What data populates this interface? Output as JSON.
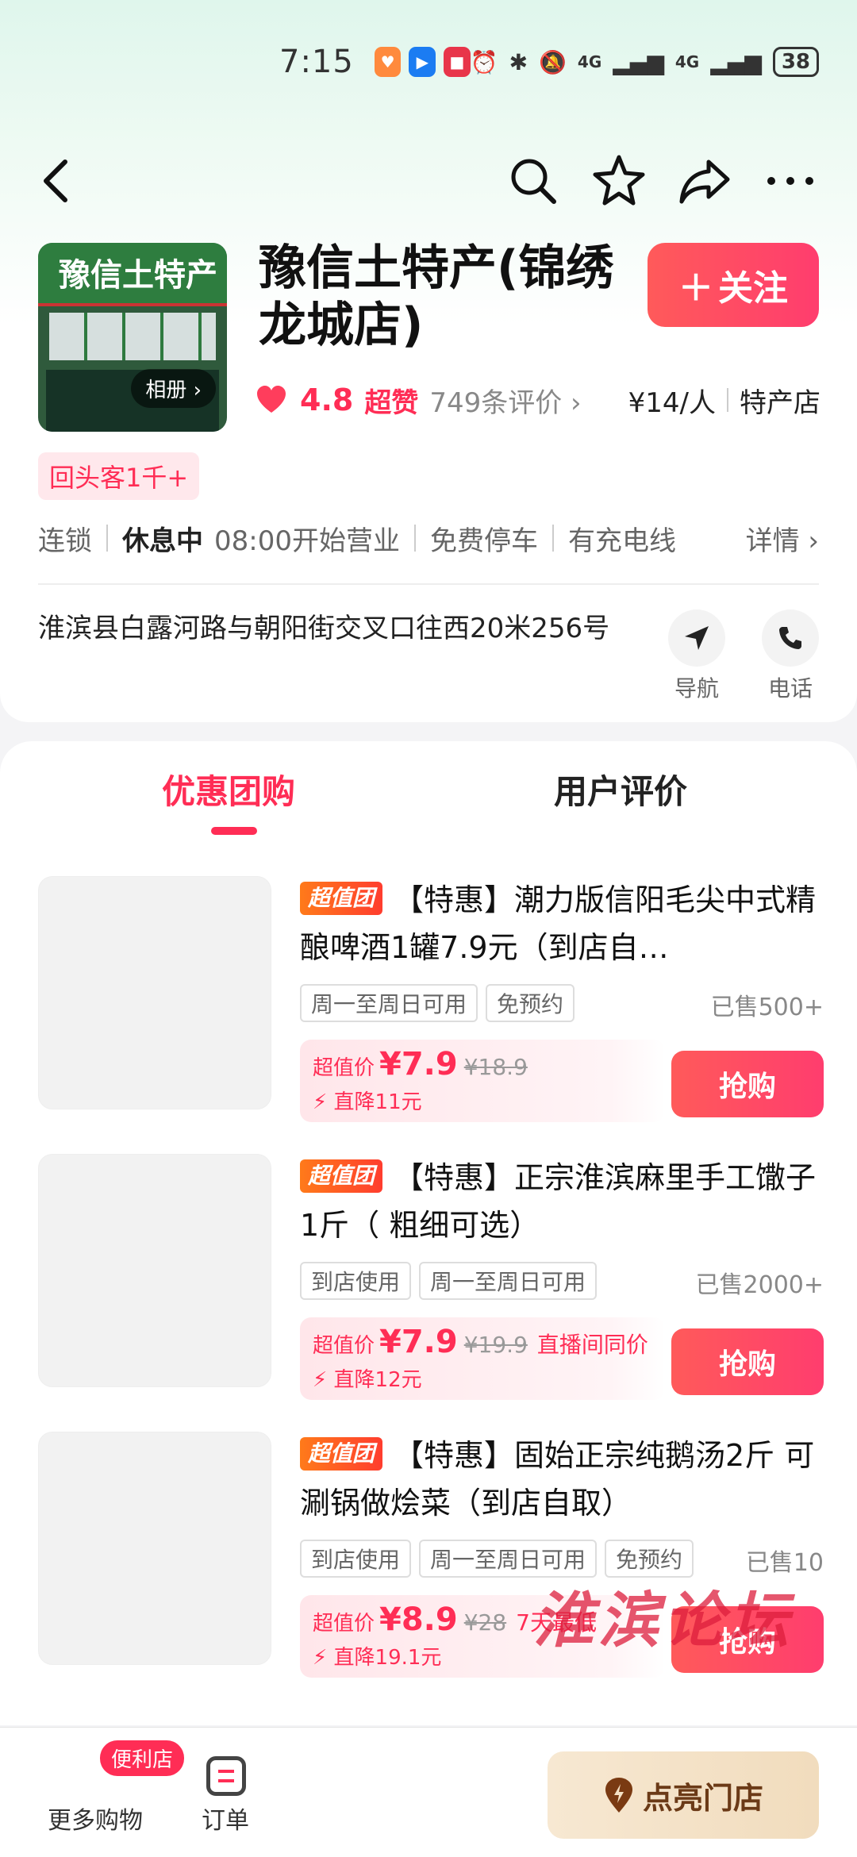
{
  "status_bar": {
    "time": "7:15",
    "network1": "4G",
    "network2": "4G",
    "battery": "38"
  },
  "store": {
    "name": "豫信土特产(锦绣龙城店)",
    "photo_sign": "豫信土特产",
    "album_label": "相册",
    "follow_label": "关注",
    "rating": "4.8",
    "rating_word": "超赞",
    "review_count": "749条评价",
    "price_per_person": "¥14/人",
    "category": "特产店",
    "return_customer_badge": "回头客1千+",
    "chain": "连锁",
    "status": "休息中",
    "hours": "08:00开始营业",
    "parking": "免费停车",
    "charging": "有充电线",
    "details": "详情",
    "address": "淮滨县白露河路与朝阳街交叉口往西20米256号",
    "nav_label": "导航",
    "phone_label": "电话"
  },
  "tabs": [
    {
      "label": "优惠团购"
    },
    {
      "label": "用户评价"
    }
  ],
  "deals": [
    {
      "badge": "超值团",
      "title": "【特惠】潮力版信阳毛尖中式精酿啤酒1罐7.9元（到店自…",
      "tags": [
        "周一至周日可用",
        "免预约"
      ],
      "sold": "已售500+",
      "price_label": "超值价",
      "price_now": "¥7.9",
      "price_orig": "¥18.9",
      "extra": "",
      "discount": "直降11元",
      "buy_label": "抢购"
    },
    {
      "badge": "超值团",
      "title": "【特惠】正宗淮滨麻里手工馓子1斤（ 粗细可选）",
      "tags": [
        "到店使用",
        "周一至周日可用"
      ],
      "sold": "已售2000+",
      "price_label": "超值价",
      "price_now": "¥7.9",
      "price_orig": "¥19.9",
      "extra": "直播间同价",
      "discount": "直降12元",
      "buy_label": "抢购"
    },
    {
      "badge": "超值团",
      "title": "【特惠】固始正宗纯鹅汤2斤 可涮锅做烩菜（到店自取）",
      "tags": [
        "到店使用",
        "周一至周日可用",
        "免预约"
      ],
      "sold": "已售10",
      "price_label": "超值价",
      "price_now": "¥8.9",
      "price_orig": "¥28",
      "extra": "7天最低",
      "discount": "直降19.1元",
      "buy_label": "抢购"
    }
  ],
  "bottom_bar": {
    "convenience_badge": "便利店",
    "more_shopping": "更多购物",
    "orders": "订单",
    "light_up": "点亮门店"
  },
  "watermark": "淮滨论坛",
  "colors": {
    "accent": "#ff2d55",
    "follow_gradient": "#ff5a5a",
    "chaozhi_orange": "#ff7a1a"
  }
}
